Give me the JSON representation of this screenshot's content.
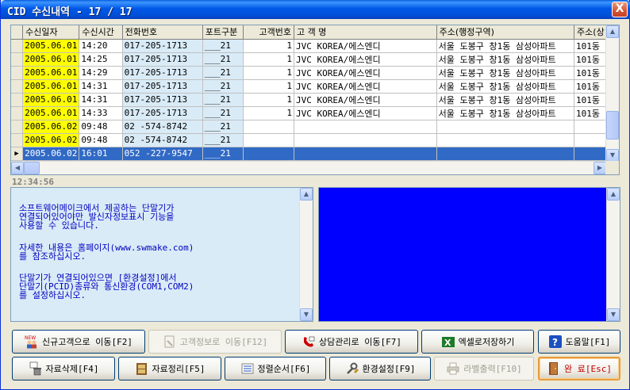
{
  "window": {
    "title": "CID 수신내역 - 17 / 17",
    "close_label": "X"
  },
  "grid": {
    "columns": [
      "수신일자",
      "수신시간",
      "전화번호",
      "포트구분",
      "고객번호",
      "고 객 명",
      "주소(행정구역)",
      "주소(상"
    ],
    "rows": [
      {
        "date": "2005.06.01",
        "time": "14:20",
        "phone": "017-205-1713",
        "port": "___21",
        "custno": "1",
        "name": "JVC KOREA/에스엔디",
        "addr": "서울 도봉구 창1동 삼성아파트",
        "addr2": "101동"
      },
      {
        "date": "2005.06.01",
        "time": "14:25",
        "phone": "017-205-1713",
        "port": "___21",
        "custno": "1",
        "name": "JVC KOREA/에스엔디",
        "addr": "서울 도봉구 창1동 삼성아파트",
        "addr2": "101동"
      },
      {
        "date": "2005.06.01",
        "time": "14:29",
        "phone": "017-205-1713",
        "port": "___21",
        "custno": "1",
        "name": "JVC KOREA/에스엔디",
        "addr": "서울 도봉구 창1동 삼성아파트",
        "addr2": "101동"
      },
      {
        "date": "2005.06.01",
        "time": "14:31",
        "phone": "017-205-1713",
        "port": "___21",
        "custno": "1",
        "name": "JVC KOREA/에스엔디",
        "addr": "서울 도봉구 창1동 삼성아파트",
        "addr2": "101동"
      },
      {
        "date": "2005.06.01",
        "time": "14:31",
        "phone": "017-205-1713",
        "port": "___21",
        "custno": "1",
        "name": "JVC KOREA/에스엔디",
        "addr": "서울 도봉구 창1동 삼성아파트",
        "addr2": "101동"
      },
      {
        "date": "2005.06.01",
        "time": "14:33",
        "phone": "017-205-1713",
        "port": "___21",
        "custno": "1",
        "name": "JVC KOREA/에스엔디",
        "addr": "서울 도봉구 창1동 삼성아파트",
        "addr2": "101동"
      },
      {
        "date": "2005.06.02",
        "time": "09:48",
        "phone": "02  -574-8742",
        "port": "___21",
        "custno": "",
        "name": "",
        "addr": "",
        "addr2": ""
      },
      {
        "date": "2005.06.02",
        "time": "09:48",
        "phone": "02  -574-8742",
        "port": "___21",
        "custno": "",
        "name": "",
        "addr": "",
        "addr2": ""
      },
      {
        "date": "2005.06.02",
        "time": "16:01",
        "phone": "052 -227-9547",
        "port": "___21",
        "custno": "",
        "name": "",
        "addr": "",
        "addr2": "",
        "selected": true
      }
    ]
  },
  "clock": "12:34:56",
  "message": {
    "lines": [
      "소프트웨어메이크에서 제공하는 단말기가",
      "연결되어있어야만 발신자정보표시 기능을",
      "사용할 수 있습니다.",
      "",
      "자세한 내용은 홈페이지(www.swmake.com)",
      "를 참조하십시오.",
      "",
      "단말기가 연결되어있으면 [환경설정]에서",
      "단말기(PCID)종류와 통신환경(COM1,COM2)",
      "를 설정하십시오."
    ]
  },
  "buttons": {
    "new_customer": "신규고객으로 이동[F2]",
    "customer_info": "고객정보로 이동[F12]",
    "consult": "상담관리로 이동[F7]",
    "excel": "엑셀로저장하기",
    "help": "도움말[F1]",
    "delete": "자료삭제[F4]",
    "cleanup": "자료정리[F5]",
    "sort": "정렬순서[F6]",
    "settings": "환경설정[F9]",
    "label_print": "라벨출력[F10]",
    "done": "완 료[Esc]",
    "new_badge": "NEW"
  },
  "colors": {
    "titlebar": "#0058e6",
    "date_highlight": "#ffff00",
    "selection": "#316ac5",
    "message_text": "#0000c0",
    "panel_blue": "#0000ff"
  }
}
